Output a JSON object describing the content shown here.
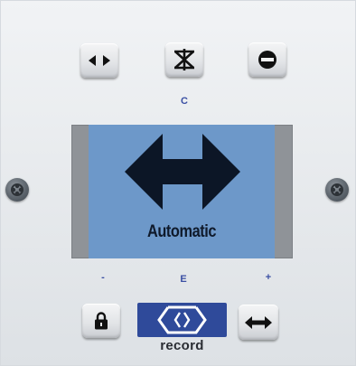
{
  "panel": {
    "labels": {
      "top_center": "C",
      "bottom_left": "-",
      "bottom_center": "E",
      "bottom_right": "+"
    },
    "display": {
      "mode": "Automatic",
      "mode_icon": "double-arrow-icon",
      "screen_color": "#6d98c9"
    },
    "buttons": {
      "top": [
        {
          "name": "direction-button",
          "icon": "left-right-triangles-icon"
        },
        {
          "name": "star-button",
          "icon": "asterisk-icon"
        },
        {
          "name": "off-button",
          "icon": "no-entry-icon"
        }
      ],
      "bottom": [
        {
          "name": "lock-button",
          "icon": "padlock-icon"
        },
        {
          "name": "automatic-button",
          "icon": "double-arrow-icon"
        }
      ]
    },
    "brand": {
      "name": "record",
      "logo_icon": "record-logo-icon",
      "logo_color": "#2f4a9a"
    }
  }
}
